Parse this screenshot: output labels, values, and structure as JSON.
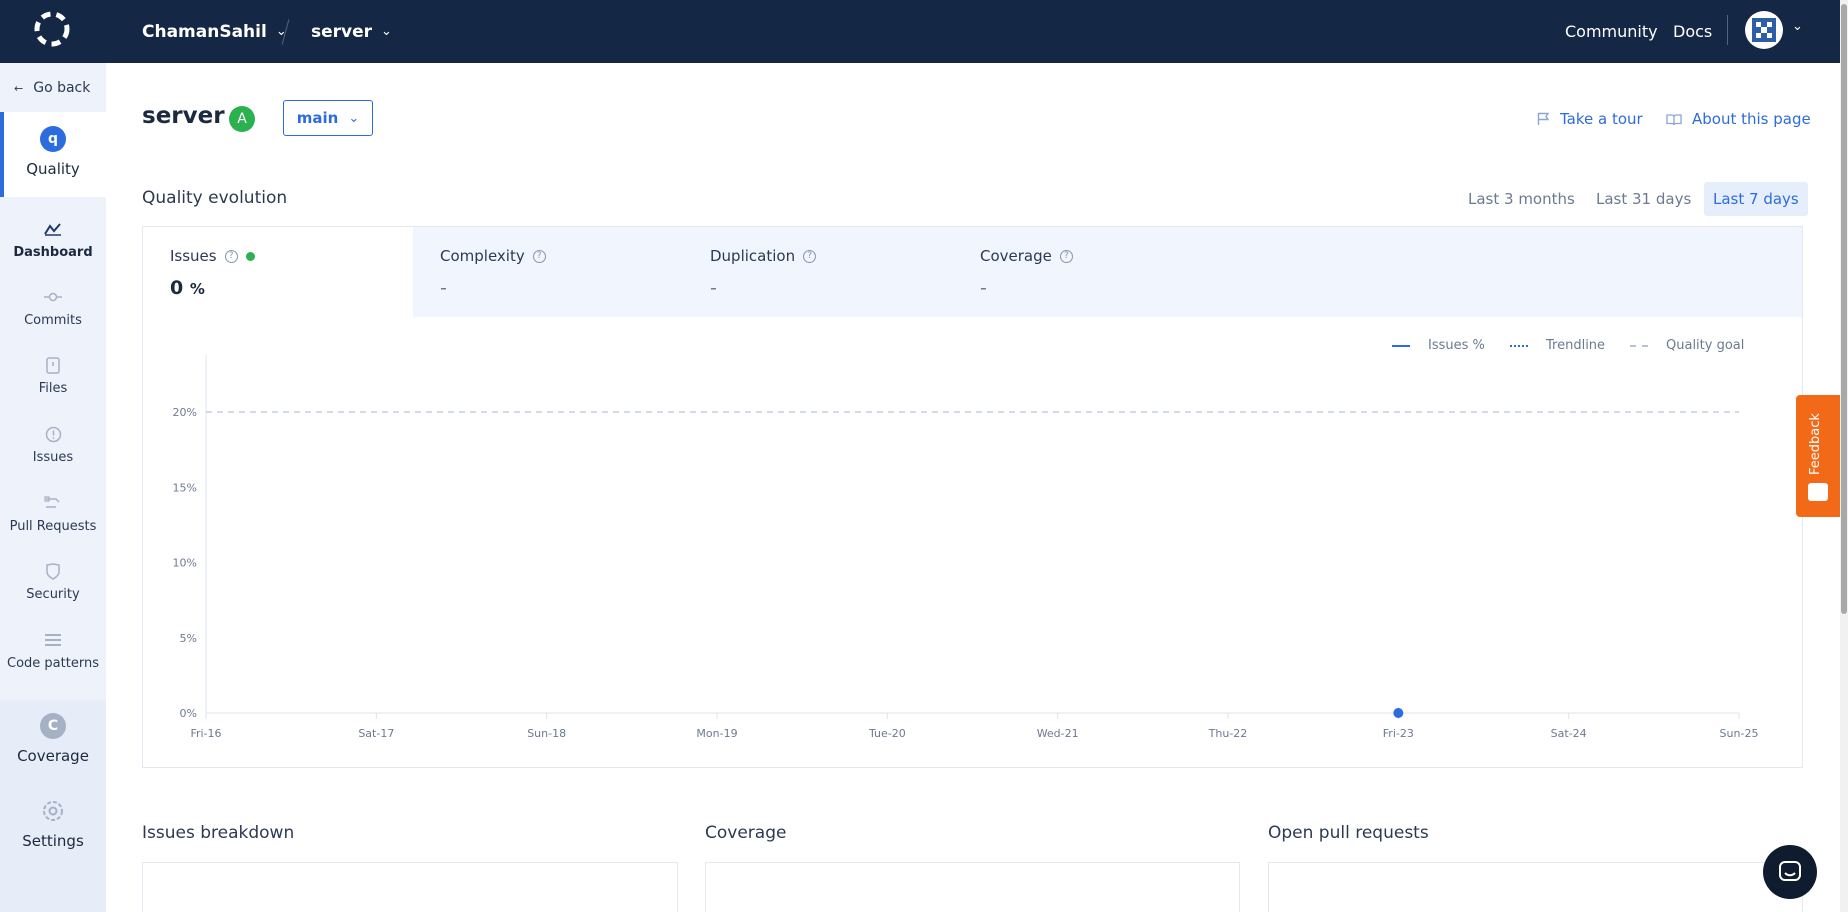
{
  "topbar": {
    "org": "ChamanSahil",
    "repo": "server",
    "links": {
      "community": "Community",
      "docs": "Docs"
    }
  },
  "sidebar": {
    "go_back": "Go back",
    "quality": "Quality",
    "nav": [
      {
        "label": "Dashboard",
        "icon": "dashboard-icon"
      },
      {
        "label": "Commits",
        "icon": "commit-icon"
      },
      {
        "label": "Files",
        "icon": "file-icon"
      },
      {
        "label": "Issues",
        "icon": "issue-icon"
      },
      {
        "label": "Pull Requests",
        "icon": "pull-request-icon"
      },
      {
        "label": "Security",
        "icon": "shield-icon"
      },
      {
        "label": "Code patterns",
        "icon": "list-icon"
      }
    ],
    "coverage": "Coverage",
    "coverage_letter": "C",
    "settings": "Settings",
    "quality_letter": "q"
  },
  "header": {
    "title": "server",
    "grade": "A",
    "branch": "main",
    "take_tour": "Take a tour",
    "about": "About this page"
  },
  "evolution": {
    "title": "Quality evolution",
    "ranges": [
      "Last 3 months",
      "Last 31 days",
      "Last 7 days"
    ],
    "active_range": "Last 7 days",
    "metrics": [
      {
        "name": "Issues",
        "value": "0",
        "unit": "%"
      },
      {
        "name": "Complexity",
        "value": "-"
      },
      {
        "name": "Duplication",
        "value": "-"
      },
      {
        "name": "Coverage",
        "value": "-"
      }
    ],
    "legend": [
      "Issues %",
      "Trendline",
      "Quality goal"
    ]
  },
  "chart_data": {
    "type": "line",
    "x": [
      "Fri-16",
      "Sat-17",
      "Sun-18",
      "Mon-19",
      "Tue-20",
      "Wed-21",
      "Thu-22",
      "Fri-23",
      "Sat-24",
      "Sun-25"
    ],
    "yticks": [
      "0%",
      "5%",
      "10%",
      "15%",
      "20%"
    ],
    "ylim": [
      0,
      24
    ],
    "series": [
      {
        "name": "Issues %",
        "points": [
          {
            "x": "Fri-23",
            "y": 0
          }
        ]
      }
    ],
    "quality_goal": 20,
    "colors": {
      "issues": "#2d6cdf",
      "goal": "#b7c3d6"
    }
  },
  "bottom": {
    "issues_breakdown": "Issues breakdown",
    "coverage": "Coverage",
    "open_prs": "Open pull requests"
  },
  "widgets": {
    "feedback": "Feedback"
  },
  "colors": {
    "topbar": "#142744",
    "accent": "#2d6cdf",
    "grade_a": "#2bb14f",
    "feedback": "#f26a18"
  }
}
